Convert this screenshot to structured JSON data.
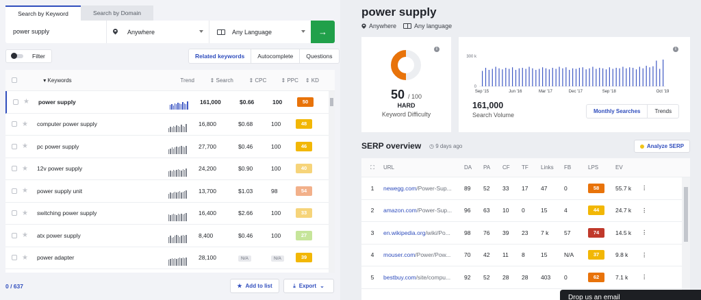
{
  "tabs": [
    "Search by Keyword",
    "Search by Domain"
  ],
  "search": {
    "keyword": "power supply",
    "location": "Anywhere",
    "language": "Any Language",
    "go": "→"
  },
  "filter_label": "Filter",
  "segments": [
    "Related keywords",
    "Autocomplete",
    "Questions"
  ],
  "table_headers": {
    "keywords": "Keywords",
    "trend": "Trend",
    "search": "Search",
    "cpc": "CPC",
    "ppc": "PPC",
    "kd": "KD"
  },
  "keywords": [
    {
      "kw": "power supply",
      "search": "161,000",
      "cpc": "$0.66",
      "ppc": "100",
      "kd": "50",
      "kd_color": "#e8730a",
      "trend": [
        8,
        9,
        7,
        10,
        9,
        11,
        10,
        9,
        12,
        10,
        9,
        13
      ]
    },
    {
      "kw": "computer power supply",
      "search": "16,800",
      "cpc": "$0.68",
      "ppc": "100",
      "kd": "48",
      "kd_color": "#f2b705",
      "trend": [
        6,
        8,
        7,
        9,
        8,
        10,
        9,
        8,
        11,
        9,
        8,
        12
      ]
    },
    {
      "kw": "pc power supply",
      "search": "27,700",
      "cpc": "$0.46",
      "ppc": "100",
      "kd": "46",
      "kd_color": "#f2b705",
      "trend": [
        7,
        8,
        9,
        8,
        9,
        10,
        9,
        10,
        11,
        10,
        9,
        11
      ]
    },
    {
      "kw": "12v power supply",
      "search": "24,200",
      "cpc": "$0.90",
      "ppc": "100",
      "kd": "40",
      "kd_color": "#f6d47a",
      "trend": [
        8,
        9,
        8,
        10,
        9,
        10,
        11,
        10,
        9,
        11,
        10,
        12
      ]
    },
    {
      "kw": "power supply unit",
      "search": "13,700",
      "cpc": "$1.03",
      "ppc": "98",
      "kd": "54",
      "kd_color": "#f2b08a",
      "trend": [
        7,
        9,
        8,
        9,
        10,
        9,
        10,
        11,
        9,
        10,
        11,
        12
      ]
    },
    {
      "kw": "switching power supply",
      "search": "16,400",
      "cpc": "$2.66",
      "ppc": "100",
      "kd": "33",
      "kd_color": "#f6d47a",
      "trend": [
        9,
        8,
        9,
        10,
        9,
        8,
        10,
        9,
        10,
        9,
        10,
        11
      ]
    },
    {
      "kw": "atx power supply",
      "search": "8,400",
      "cpc": "$0.46",
      "ppc": "100",
      "kd": "27",
      "kd_color": "#c6e59a",
      "trend": [
        8,
        9,
        7,
        8,
        9,
        10,
        9,
        8,
        9,
        10,
        9,
        10
      ]
    },
    {
      "kw": "power adapter",
      "search": "28,100",
      "cpc": "N/A",
      "ppc": "N/A",
      "kd": "39",
      "kd_color": "#f2b705",
      "trend": [
        7,
        8,
        9,
        8,
        9,
        8,
        9,
        10,
        9,
        10,
        9,
        10
      ]
    }
  ],
  "count": "0 / 637",
  "add_to_list": "Add to list",
  "export": "Export",
  "title": "power supply",
  "sub_location": "Anywhere",
  "sub_language": "Any language",
  "kd_value": "50",
  "kd_max": "/ 100",
  "kd_level": "HARD",
  "kd_label": "Keyword Difficulty",
  "volume": "161,000",
  "volume_label": "Search Volume",
  "vol_chart": {
    "ytick_top": "300 k",
    "ytick_bottom": "0",
    "xticks": [
      "Sep '15",
      "Jun '16",
      "Mar '17",
      "Dec '17",
      "Sep '18",
      "Oct '19"
    ],
    "values": [
      150,
      180,
      160,
      170,
      190,
      175,
      165,
      180,
      170,
      185,
      160,
      175,
      180,
      170,
      190,
      175,
      160,
      170,
      185,
      175,
      165,
      180,
      170,
      190,
      175,
      185,
      160,
      175,
      170,
      180,
      185,
      165,
      175,
      190,
      170,
      180,
      175,
      165,
      185,
      170,
      180,
      175,
      190,
      175,
      185,
      180,
      165,
      190,
      175,
      200,
      185,
      195,
      250,
      170,
      260
    ]
  },
  "vol_tabs": [
    "Monthly Searches",
    "Trends"
  ],
  "serp_title": "SERP overview",
  "serp_ago": "9 days ago",
  "analyze": "Analyze SERP",
  "serp_headers": {
    "url": "URL",
    "da": "DA",
    "pa": "PA",
    "cf": "CF",
    "tf": "TF",
    "links": "Links",
    "fb": "FB",
    "lps": "LPS",
    "ev": "EV"
  },
  "serp": [
    {
      "n": "1",
      "domain": "newegg.com",
      "path": "/Power-Sup...",
      "da": "89",
      "pa": "52",
      "cf": "33",
      "tf": "17",
      "links": "47",
      "fb": "0",
      "lps": "58",
      "lps_color": "#e8730a",
      "ev": "55.7 k"
    },
    {
      "n": "2",
      "domain": "amazon.com",
      "path": "/Power-Sup...",
      "da": "96",
      "pa": "63",
      "cf": "10",
      "tf": "0",
      "links": "15",
      "fb": "4",
      "lps": "44",
      "lps_color": "#f2b705",
      "ev": "24.7 k"
    },
    {
      "n": "3",
      "domain": "en.wikipedia.org",
      "path": "/wiki/Po...",
      "da": "98",
      "pa": "76",
      "cf": "39",
      "tf": "23",
      "links": "7 k",
      "fb": "57",
      "lps": "74",
      "lps_color": "#c0392b",
      "ev": "14.5 k"
    },
    {
      "n": "4",
      "domain": "mouser.com",
      "path": "/Power/Pow...",
      "da": "70",
      "pa": "42",
      "cf": "11",
      "tf": "8",
      "links": "15",
      "fb": "N/A",
      "lps": "37",
      "lps_color": "#f2b705",
      "ev": "9.8 k"
    },
    {
      "n": "5",
      "domain": "bestbuy.com",
      "path": "/site/compu...",
      "da": "92",
      "pa": "52",
      "cf": "28",
      "tf": "28",
      "links": "403",
      "fb": "0",
      "lps": "62",
      "lps_color": "#e8730a",
      "ev": "7.1 k"
    }
  ],
  "toast": "Drop us an email"
}
